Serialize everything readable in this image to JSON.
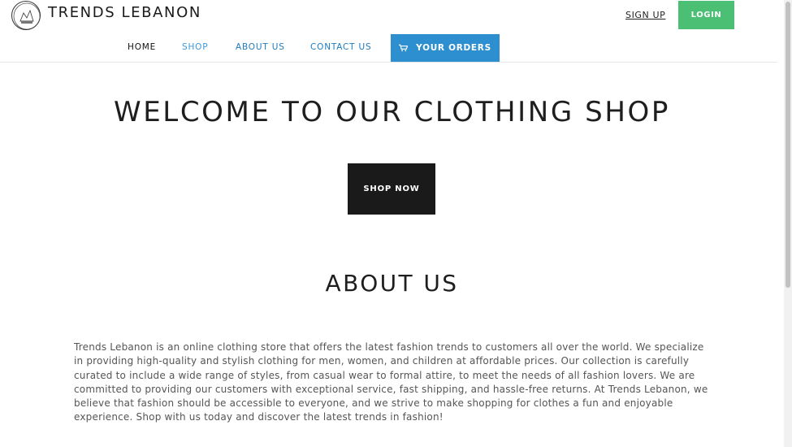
{
  "header": {
    "brand": "TRENDS LEBANON",
    "signup_label": "SIGN UP",
    "login_label": "LOGIN"
  },
  "nav": {
    "items": [
      {
        "label": "HOME"
      },
      {
        "label": "SHOP"
      },
      {
        "label": "ABOUT US"
      },
      {
        "label": "CONTACT US"
      }
    ],
    "orders_label": "YOUR ORDERS",
    "orders_icon": "cart-icon"
  },
  "hero": {
    "title": "WELCOME TO OUR CLOTHING SHOP",
    "button_label": "SHOP NOW"
  },
  "about": {
    "title": "ABOUT US",
    "text": "Trends Lebanon is an online clothing store that offers the latest fashion trends to customers all over the world. We specialize in providing high-quality and stylish clothing for men, women, and children at affordable prices. Our collection is carefully curated to include a wide range of styles, from casual wear to formal attire, to meet the needs of all fashion lovers. We are committed to providing our customers with exceptional service, fast shipping, and hassle-free returns. At Trends Lebanon, we believe that fashion should be accessible to everyone, and we strive to make shopping for clothes a fun and enjoyable experience. Shop with us today and discover the latest trends in fashion!"
  },
  "colors": {
    "login_bg": "#4bbf73",
    "orders_bg": "#2e8fd0",
    "shop_now_bg": "#1a1a1a",
    "nav_link": "#1f7bbf"
  }
}
